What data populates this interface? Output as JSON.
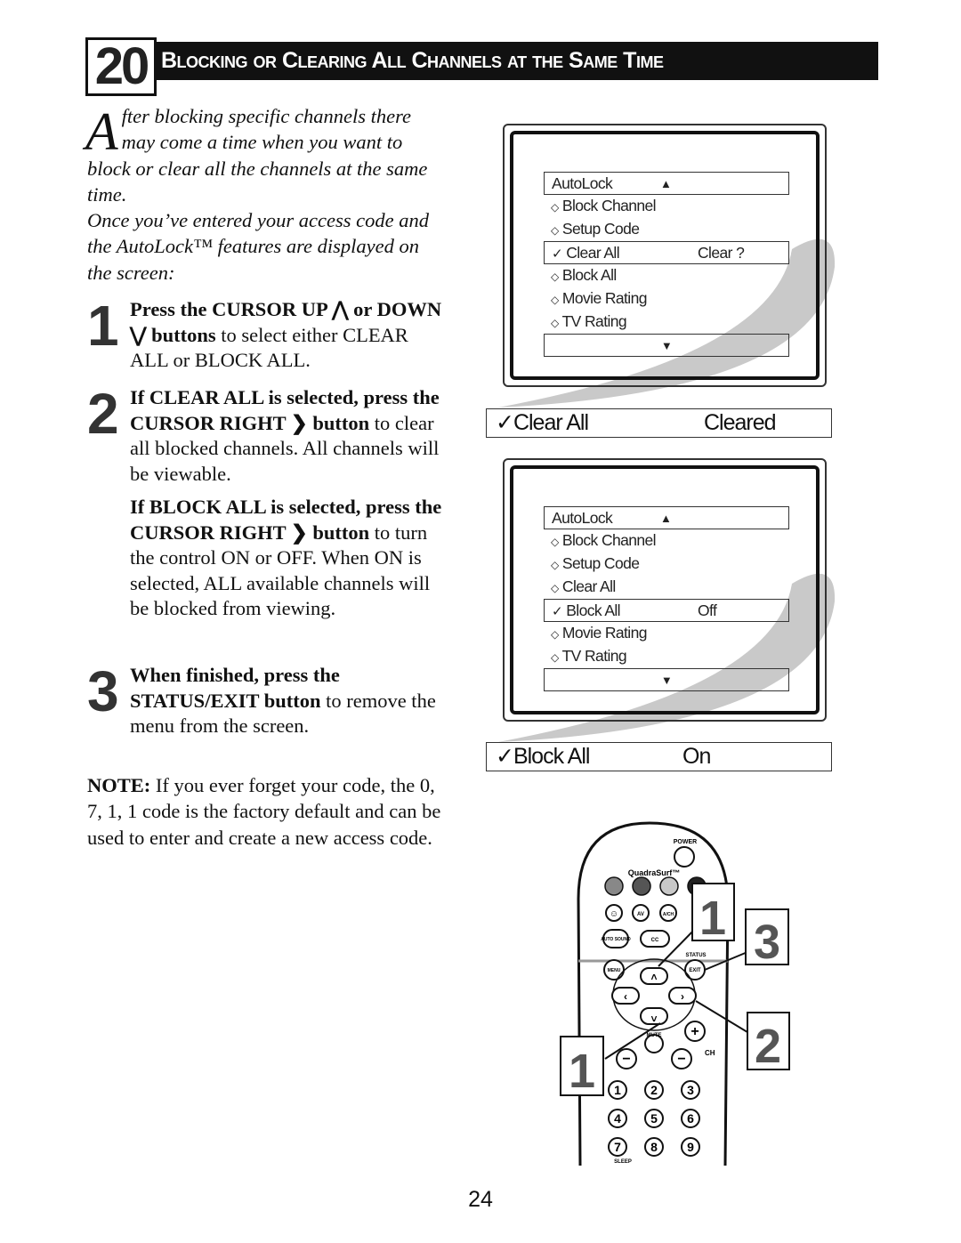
{
  "header": {
    "number": "20",
    "title": "Blocking or Clearing All Channels at the Same Time"
  },
  "intro": {
    "drop_cap": "A",
    "text1": "fter blocking specific channels there may come a time when you want to block or clear all the channels at the same time.",
    "text2": "Once you’ve entered your access code and the AutoLock™ features are displayed on the screen:"
  },
  "steps": [
    {
      "number": "1",
      "bold": "Press the CURSOR UP ⋀ or DOWN ⋁ buttons",
      "rest": " to select either CLEAR ALL or BLOCK ALL."
    },
    {
      "number": "2",
      "bold": "If CLEAR ALL is selected, press the CURSOR RIGHT ❯ button",
      "rest": " to clear all blocked channels. All channels will be viewable."
    },
    {
      "number": "",
      "bold": "If BLOCK ALL is selected, press the CURSOR RIGHT ❯ button",
      "rest": " to turn the control ON or OFF. When ON is selected, ALL available channels will be blocked from viewing."
    },
    {
      "number": "3",
      "bold": "When finished, press the STATUS/EXIT button",
      "rest": " to remove the menu from the screen."
    }
  ],
  "note": {
    "label": "NOTE:",
    "text": " If you ever forget your code, the 0, 7, 1, 1 code is the factory default and can be used to enter and create a new access code."
  },
  "menu1": {
    "title": "AutoLock",
    "up": "▲",
    "down": "▼",
    "items": [
      {
        "mark": "◇",
        "label": "Block Channel",
        "value": ""
      },
      {
        "mark": "◇",
        "label": "Setup Code",
        "value": ""
      },
      {
        "mark": "✓",
        "label": "Clear All",
        "value": "Clear ?"
      },
      {
        "mark": "◇",
        "label": "Block All",
        "value": ""
      },
      {
        "mark": "◇",
        "label": "Movie Rating",
        "value": ""
      },
      {
        "mark": "◇",
        "label": "TV Rating",
        "value": ""
      }
    ],
    "result": {
      "mark": "✓",
      "label": "Clear All",
      "value": "Cleared"
    }
  },
  "menu2": {
    "title": "AutoLock",
    "up": "▲",
    "down": "▼",
    "items": [
      {
        "mark": "◇",
        "label": "Block Channel",
        "value": ""
      },
      {
        "mark": "◇",
        "label": "Setup Code",
        "value": ""
      },
      {
        "mark": "◇",
        "label": "Clear All",
        "value": ""
      },
      {
        "mark": "✓",
        "label": "Block All",
        "value": "Off"
      },
      {
        "mark": "◇",
        "label": "Movie Rating",
        "value": ""
      },
      {
        "mark": "◇",
        "label": "TV Rating",
        "value": ""
      }
    ],
    "result": {
      "mark": "✓",
      "label": "Block All",
      "value": "On"
    }
  },
  "remote": {
    "power": "POWER",
    "quadrasurf": "QuadraSurf™",
    "av": "AV",
    "ach": "A/CH",
    "auto_sound": "AUTO SOUND",
    "cc": "CC",
    "status": "STATUS",
    "menu": "MENU",
    "exit": "EXIT",
    "mute": "MUTE",
    "ch": "CH",
    "sleep": "SLEEP",
    "digits": [
      "1",
      "2",
      "3",
      "4",
      "5",
      "6",
      "7",
      "8",
      "9"
    ],
    "callouts": [
      "1",
      "3",
      "2",
      "1"
    ],
    "quadrasurf_colors": [
      "#888888",
      "#555555",
      "#c8c8c8",
      "#222222"
    ]
  },
  "page_number": "24"
}
